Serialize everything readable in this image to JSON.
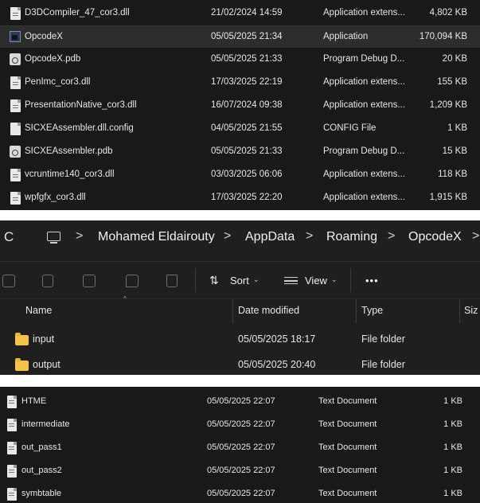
{
  "panel1": {
    "files": [
      {
        "name": "D3DCompiler_47_cor3.dll",
        "date": "21/02/2024 14:59",
        "type": "Application extens...",
        "size": "4,802 KB",
        "icon": "dll-file-icon"
      },
      {
        "name": "OpcodeX",
        "date": "05/05/2025 21:34",
        "type": "Application",
        "size": "170,094 KB",
        "icon": "exe-file-icon"
      },
      {
        "name": "OpcodeX.pdb",
        "date": "05/05/2025 21:33",
        "type": "Program Debug D...",
        "size": "20 KB",
        "icon": "pdb-file-icon"
      },
      {
        "name": "PenImc_cor3.dll",
        "date": "17/03/2025 22:19",
        "type": "Application extens...",
        "size": "155 KB",
        "icon": "dll-file-icon"
      },
      {
        "name": "PresentationNative_cor3.dll",
        "date": "16/07/2024 09:38",
        "type": "Application extens...",
        "size": "1,209 KB",
        "icon": "dll-file-icon"
      },
      {
        "name": "SICXEAssembler.dll.config",
        "date": "04/05/2025 21:55",
        "type": "CONFIG File",
        "size": "1 KB",
        "icon": "config-file-icon"
      },
      {
        "name": "SICXEAssembler.pdb",
        "date": "05/05/2025 21:33",
        "type": "Program Debug D...",
        "size": "15 KB",
        "icon": "pdb-file-icon"
      },
      {
        "name": "vcruntime140_cor3.dll",
        "date": "03/03/2025 06:06",
        "type": "Application extens...",
        "size": "118 KB",
        "icon": "dll-file-icon"
      },
      {
        "name": "wpfgfx_cor3.dll",
        "date": "17/03/2025 22:20",
        "type": "Application extens...",
        "size": "1,915 KB",
        "icon": "dll-file-icon"
      }
    ]
  },
  "panel2": {
    "refresh_glyph": "C",
    "breadcrumb": [
      "Mohamed Eldairouty",
      "AppData",
      "Roaming",
      "OpcodeX"
    ],
    "toolbar": {
      "sort_label": "Sort",
      "view_label": "View",
      "more_label": "•••"
    },
    "columns": {
      "name": "Name",
      "date": "Date modified",
      "type": "Type",
      "size": "Siz"
    },
    "folders": [
      {
        "name": "input",
        "date": "05/05/2025 18:17",
        "type": "File folder"
      },
      {
        "name": "output",
        "date": "05/05/2025 20:40",
        "type": "File folder"
      }
    ]
  },
  "panel3": {
    "files": [
      {
        "name": "HTME",
        "date": "05/05/2025 22:07",
        "type": "Text Document",
        "size": "1 KB"
      },
      {
        "name": "intermediate",
        "date": "05/05/2025 22:07",
        "type": "Text Document",
        "size": "1 KB"
      },
      {
        "name": "out_pass1",
        "date": "05/05/2025 22:07",
        "type": "Text Document",
        "size": "1 KB"
      },
      {
        "name": "out_pass2",
        "date": "05/05/2025 22:07",
        "type": "Text Document",
        "size": "1 KB"
      },
      {
        "name": "symbtable",
        "date": "05/05/2025 22:07",
        "type": "Text Document",
        "size": "1 KB"
      }
    ]
  }
}
